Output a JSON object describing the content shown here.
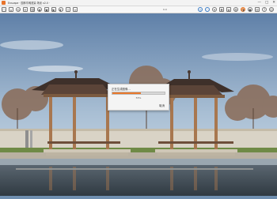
{
  "window": {
    "title": "Enscape · 园林亭阁渲染 场景 v2.0 ·",
    "minimize_glyph": "—",
    "maximize_glyph": "□",
    "close_glyph": "✕"
  },
  "toolbar": {
    "left_tools": [
      {
        "icon": "folder-icon",
        "glyph": "▢"
      },
      {
        "icon": "home-icon",
        "glyph": "⌂"
      },
      {
        "icon": "walk-icon",
        "glyph": "⟲"
      },
      {
        "icon": "fly-icon",
        "glyph": "✈"
      },
      {
        "icon": "link-icon",
        "glyph": "⛓"
      },
      {
        "icon": "camera-icon",
        "glyph": "◉"
      },
      {
        "icon": "screenshot-icon",
        "glyph": "▣"
      },
      {
        "icon": "video-icon",
        "glyph": "▶"
      },
      {
        "icon": "panorama-icon",
        "glyph": "◐"
      },
      {
        "icon": "export-icon",
        "glyph": "⇪"
      },
      {
        "icon": "batch-icon",
        "glyph": "≡"
      }
    ],
    "center_label": "0.0",
    "right_tools": [
      {
        "icon": "sun-icon",
        "glyph": "☼",
        "accent": "blue"
      },
      {
        "icon": "atmosphere-icon",
        "glyph": "◌",
        "accent": "blue"
      },
      {
        "icon": "light-view-icon",
        "glyph": "✦"
      },
      {
        "icon": "asset-library-icon",
        "glyph": "♣"
      },
      {
        "icon": "material-editor-icon",
        "glyph": "◈"
      },
      {
        "icon": "settings-icon",
        "glyph": "⚙"
      },
      {
        "icon": "visual-settings-icon",
        "glyph": "◑",
        "accent": "orange"
      },
      {
        "icon": "render-icon",
        "glyph": "●"
      },
      {
        "icon": "feedback-icon",
        "glyph": "✉"
      },
      {
        "icon": "help-icon",
        "glyph": "?"
      },
      {
        "icon": "account-icon",
        "glyph": "☺"
      }
    ]
  },
  "dialog": {
    "title": "正在生成图像…",
    "progress_percent": 55,
    "progress_text": "55%",
    "cancel_label": "取消"
  },
  "colors": {
    "accent": "#e9782b",
    "sky_top": "#6f8fb0",
    "sky_bottom": "#c7d6e4",
    "roof": "#4a3a33",
    "pillar": "#a8774f",
    "wall": "#d9d3c6",
    "grass": "#6f8a46",
    "water": "#3f4b55"
  }
}
